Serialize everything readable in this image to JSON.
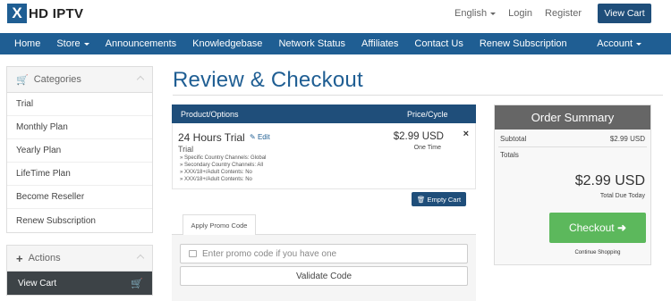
{
  "brand": {
    "mark": "X",
    "name": "HD IPTV"
  },
  "top_links": {
    "language": "English",
    "login": "Login",
    "register": "Register",
    "view_cart": "View Cart"
  },
  "nav": {
    "items": [
      "Home",
      "Store",
      "Announcements",
      "Knowledgebase",
      "Network Status",
      "Affiliates",
      "Contact Us",
      "Renew Subscription"
    ],
    "account": "Account"
  },
  "sidebar": {
    "categories_title": "Categories",
    "categories": [
      "Trial",
      "Monthly Plan",
      "Yearly Plan",
      "LifeTime Plan",
      "Become Reseller",
      "Renew Subscription"
    ],
    "actions_title": "Actions",
    "view_cart": "View Cart"
  },
  "page": {
    "title": "Review & Checkout"
  },
  "cart": {
    "col_product": "Product/Options",
    "col_price": "Price/Cycle",
    "item": {
      "name": "24 Hours Trial",
      "edit": "Edit",
      "group": "Trial",
      "options": [
        "» Specific Country Channels: Global",
        "» Secondary Country Channels: All",
        "» XXX/18+/Adult Contents: No",
        "» XXX/18+/Adult Contents: No"
      ],
      "price": "$2.99 USD",
      "cycle": "One Time",
      "remove": "×"
    },
    "empty_cart": "Empty Cart"
  },
  "promo": {
    "tab": "Apply Promo Code",
    "placeholder": "Enter promo code if you have one",
    "validate": "Validate Code"
  },
  "summary": {
    "title": "Order Summary",
    "subtotal_label": "Subtotal",
    "subtotal_value": "$2.99 USD",
    "totals_label": "Totals",
    "total": "$2.99 USD",
    "total_due_label": "Total Due Today",
    "checkout": "Checkout",
    "continue": "Continue Shopping"
  },
  "colors": {
    "primary": "#1f5e93",
    "dark_primary": "#1f4e7a",
    "checkout_green": "#5cb85c",
    "summary_header": "#666666"
  }
}
